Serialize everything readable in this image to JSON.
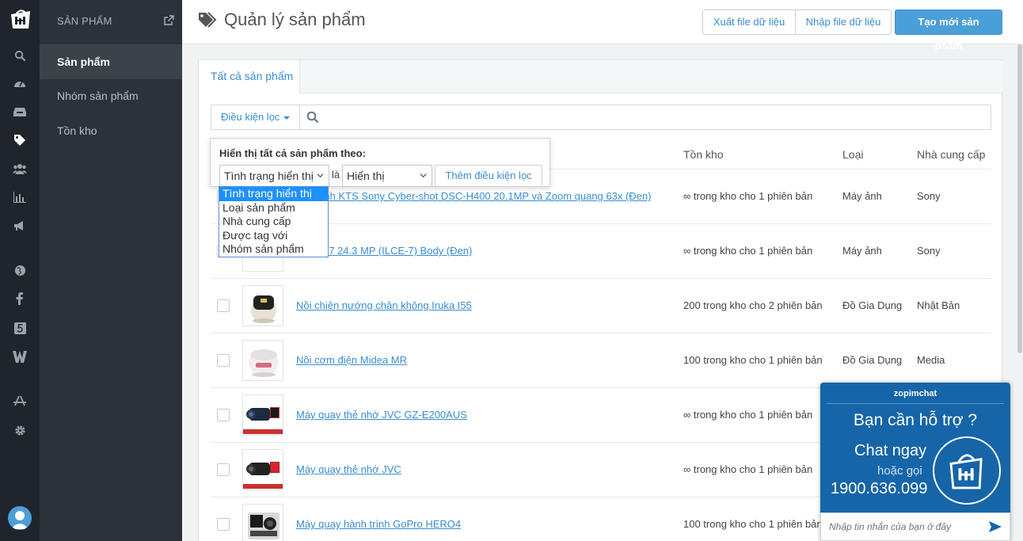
{
  "subnav": {
    "header": "SẢN PHẨM",
    "items": [
      {
        "label": "Sản phẩm",
        "active": true
      },
      {
        "label": "Nhóm sản phẩm",
        "active": false
      },
      {
        "label": "Tồn kho",
        "active": false
      }
    ]
  },
  "rail_icons": [
    "search-icon",
    "dashboard-icon",
    "inbox-icon",
    "tag-icon",
    "users-icon",
    "chart-icon",
    "megaphone-icon",
    "globe-icon",
    "facebook-icon",
    "five-icon",
    "w-icon",
    "app-store-icon",
    "gear-icon"
  ],
  "header": {
    "title": "Quản lý sản phẩm",
    "export_label": "Xuất file dữ liệu",
    "import_label": "Nhập file dữ liệu",
    "create_label": "Tạo mới sản phẩm"
  },
  "tabs": [
    {
      "label": "Tất cả sản phẩm"
    }
  ],
  "filter": {
    "button_label": "Điều kiện lọc",
    "search_placeholder": ""
  },
  "popover": {
    "title": "Hiển thị tất cả sản phẩm theo:",
    "field_value": "Tình trạng hiển thị",
    "connector": "là",
    "value_value": "Hiển thị",
    "add_label": "Thêm điều kiện lọc",
    "options": [
      "Tình trạng hiển thị",
      "Loại sản phẩm",
      "Nhà cung cấp",
      "Được tag với",
      "Nhóm sản phẩm"
    ]
  },
  "columns": {
    "stock": "Tồn kho",
    "type": "Loại",
    "vendor": "Nhà cung cấp"
  },
  "rows": [
    {
      "name": "Máy ảnh KTS Sony Cyber-shot DSC-H400 20.1MP và Zoom quang 63x (Đen)",
      "stock": "∞ trong kho cho 1 phiên bản",
      "type": "Máy ảnh",
      "vendor": "Sony"
    },
    {
      "name": "Sony A7 24.3 MP (ILCE-7) Body (Đen)",
      "stock": "∞ trong kho cho 1 phiên bản",
      "type": "Máy ảnh",
      "vendor": "Sony"
    },
    {
      "name": "Nồi chiên nướng chân không Iruka I55",
      "stock": "200 trong kho cho 2 phiên bản",
      "type": "Đồ Gia Dụng",
      "vendor": "Nhật Bản"
    },
    {
      "name": "Nồi cơm điện Midea MR",
      "stock": "100 trong kho cho 1 phiên bản",
      "type": "Đồ Gia Dụng",
      "vendor": "Media"
    },
    {
      "name": "Máy quay thẻ nhớ JVC GZ-E200AUS",
      "stock": "∞ trong kho cho 1 phiên bản",
      "type": "",
      "vendor": ""
    },
    {
      "name": "Máy quay thẻ nhớ JVC",
      "stock": "∞ trong kho cho 1 phiên bản",
      "type": "",
      "vendor": ""
    },
    {
      "name": "Máy quay hành trình GoPro HERO4",
      "stock": "100 trong kho cho 1 phiên bản",
      "type": "",
      "vendor": ""
    }
  ],
  "chat": {
    "brand": "zopimchat",
    "question": "Bạn cần hỗ trợ ?",
    "chat_now": "Chat ngay",
    "or_call": "hoặc gọi",
    "phone": "1900.636.099",
    "input_placeholder": "Nhập tin nhắn của bạn ở đây"
  },
  "colors": {
    "accent": "#4a9fd8",
    "link": "#3a8dd0",
    "rail": "#1f252b",
    "subnav": "#2c3238",
    "chat": "#1565a8"
  }
}
